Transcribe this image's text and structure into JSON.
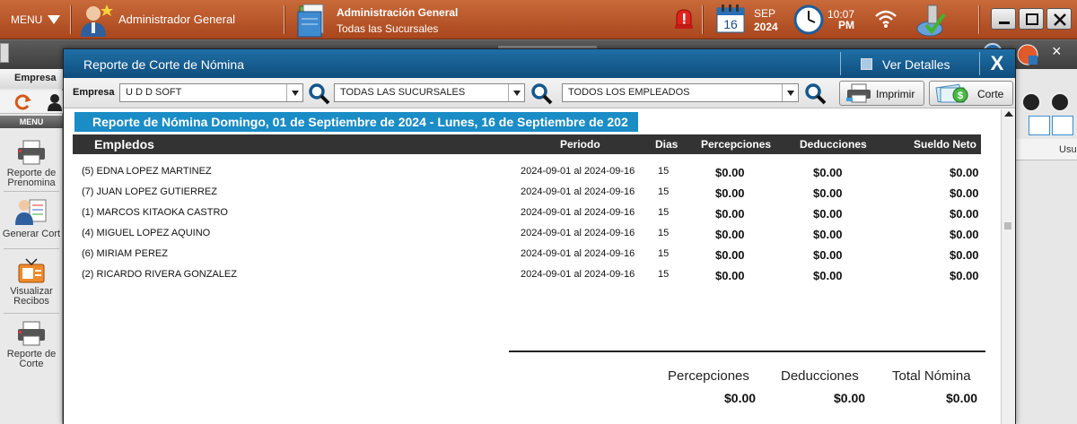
{
  "topbar": {
    "menu_label": "MENU",
    "user_name": "Administrador General",
    "admin_title": "Administración General",
    "admin_subtitle": "Todas las Sucursales",
    "calendar_day": "16",
    "calendar_month": "SEP",
    "calendar_year": "2024",
    "time": "10:07",
    "ampm": "PM"
  },
  "left_panel": {
    "tab_label": "Empresa",
    "menu_header": "MENU",
    "items": [
      {
        "label": "Reporte de Prenomina"
      },
      {
        "label": "Generar Cort"
      },
      {
        "label": "Visualizar Recibos"
      },
      {
        "label": "Reporte de Corte"
      }
    ]
  },
  "right_panel": {
    "column_header": "Usua"
  },
  "modal": {
    "title": "Reporte de Corte de Nómina",
    "details_label": "Ver Detalles",
    "close_label": "X",
    "filters": {
      "empresa_label": "Empresa",
      "empresa_value": "U D D SOFT",
      "sucursal_value": "TODAS LAS SUCURSALES",
      "empleados_value": "TODOS LOS EMPLEADOS",
      "print_label": "Imprimir",
      "corte_label": "Corte"
    },
    "report": {
      "banner": "Reporte de Nómina Domingo, 01 de Septiembre de 2024 - Lunes, 16 de Septiembre de 202",
      "columns": {
        "empleados": "Empledos",
        "periodo": "Periodo",
        "dias": "Dias",
        "percepciones": "Percepciones",
        "deducciones": "Deducciones",
        "sueldo_neto": "Sueldo Neto"
      },
      "rows": [
        {
          "empleado": "(5) EDNA LOPEZ MARTINEZ",
          "periodo": "2024-09-01 al 2024-09-16",
          "dias": "15",
          "percepciones": "$0.00",
          "deducciones": "$0.00",
          "sueldo_neto": "$0.00"
        },
        {
          "empleado": "(7) JUAN LOPEZ GUTIERREZ",
          "periodo": "2024-09-01 al 2024-09-16",
          "dias": "15",
          "percepciones": "$0.00",
          "deducciones": "$0.00",
          "sueldo_neto": "$0.00"
        },
        {
          "empleado": "(1) MARCOS KITAOKA CASTRO",
          "periodo": "2024-09-01 al 2024-09-16",
          "dias": "15",
          "percepciones": "$0.00",
          "deducciones": "$0.00",
          "sueldo_neto": "$0.00"
        },
        {
          "empleado": "(4) MIGUEL LOPEZ AQUINO",
          "periodo": "2024-09-01 al 2024-09-16",
          "dias": "15",
          "percepciones": "$0.00",
          "deducciones": "$0.00",
          "sueldo_neto": "$0.00"
        },
        {
          "empleado": "(6) MIRIAM PEREZ",
          "periodo": "2024-09-01 al 2024-09-16",
          "dias": "15",
          "percepciones": "$0.00",
          "deducciones": "$0.00",
          "sueldo_neto": "$0.00"
        },
        {
          "empleado": "(2) RICARDO RIVERA GONZALEZ",
          "periodo": "2024-09-01 al 2024-09-16",
          "dias": "15",
          "percepciones": "$0.00",
          "deducciones": "$0.00",
          "sueldo_neto": "$0.00"
        }
      ],
      "totals": {
        "percepciones_label": "Percepciones",
        "deducciones_label": "Deducciones",
        "total_label": "Total Nómina",
        "percepciones_value": "$0.00",
        "deducciones_value": "$0.00",
        "total_value": "$0.00"
      }
    }
  },
  "colors": {
    "topbar": "#b8532a",
    "modal_header": "#15598c",
    "banner": "#1a8cc6",
    "table_header": "#333333"
  },
  "icons": [
    "user-icon",
    "admin-folder-icon",
    "alert-icon",
    "calendar-icon",
    "clock-icon",
    "wifi-icon",
    "network-icon",
    "printer-icon",
    "magnifier-icon",
    "cash-icon"
  ]
}
